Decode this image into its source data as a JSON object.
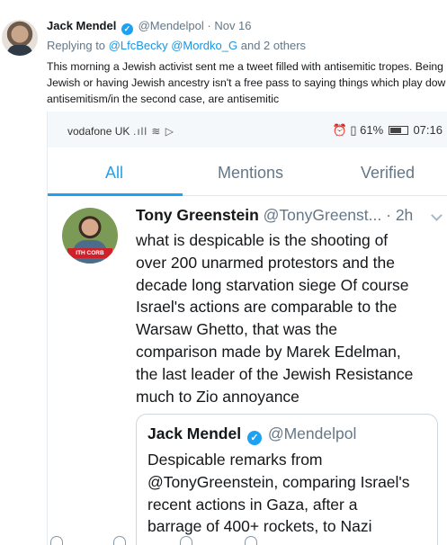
{
  "outer": {
    "name": "Jack Mendel",
    "handle": "@Mendelpol",
    "date": "· Nov 16",
    "reply_prefix": "Replying to",
    "reply_users": "@LfcBecky @Mordko_G",
    "reply_suffix": "and 2 others",
    "text_lines": [
      "This morning a Jewish activist sent me a tweet filled with antisemitic tropes. Being",
      "Jewish or having Jewish ancestry isn't a free pass to saying things which play dow",
      "antisemitism/in the second case, are antisemitic"
    ]
  },
  "status_bar": {
    "carrier": "vodafone UK",
    "battery": "61%",
    "time": "07:16"
  },
  "tabs": [
    "All",
    "Mentions",
    "Verified"
  ],
  "tweet": {
    "name": "Tony Greenstein",
    "handle": "@TonyGreenst...",
    "time": "· 2h",
    "avatar_banner": "ITH CORB",
    "body_lines": [
      "what is despicable is the shooting of",
      "over 200 unarmed protestors and the",
      "decade long starvation siege Of course",
      "Israel's actions are comparable to the",
      "Warsaw Ghetto, that was the",
      "comparison made by Marek Edelman,",
      "the last leader of the Jewish Resistance",
      "much to Zio annoyance"
    ]
  },
  "quote": {
    "name": "Jack Mendel",
    "handle": "@Mendelpol",
    "body_lines": [
      "Despicable remarks from",
      "@TonyGreenstein, comparing Israel's",
      "recent actions in Gaza, after a",
      "barrage of 400+ rockets, to Nazi"
    ]
  },
  "colors": {
    "accent": "#1da1f2",
    "muted": "#657786",
    "link": "#1b95e0"
  }
}
